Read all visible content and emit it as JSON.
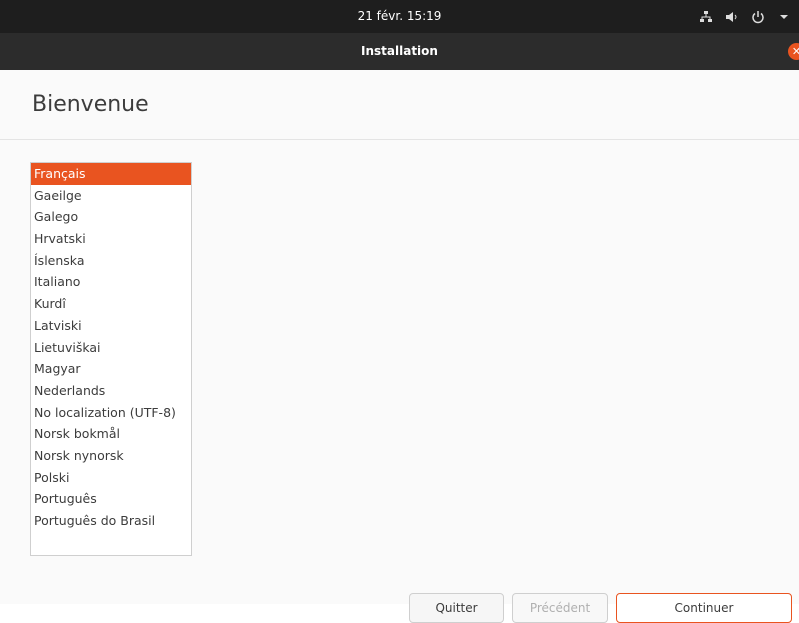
{
  "topbar": {
    "clock": "21 févr.  15:19",
    "icons": [
      "network-icon",
      "volume-icon",
      "power-icon",
      "menu-arrow-icon"
    ]
  },
  "window": {
    "title": "Installation",
    "close_icon": "close-icon"
  },
  "page": {
    "heading": "Bienvenue"
  },
  "languages": {
    "selected_index": 0,
    "items": [
      "Français",
      "Gaeilge",
      "Galego",
      "Hrvatski",
      "Íslenska",
      "Italiano",
      "Kurdî",
      "Latviski",
      "Lietuviškai",
      "Magyar",
      "Nederlands",
      "No localization (UTF-8)",
      "Norsk bokmål",
      "Norsk nynorsk",
      "Polski",
      "Português",
      "Português do Brasil"
    ]
  },
  "buttons": {
    "quit": "Quitter",
    "previous": "Précédent",
    "continue": "Continuer"
  },
  "colors": {
    "accent": "#e95420",
    "topbar": "#1e1e1e",
    "titlebar": "#2c2c2c"
  }
}
